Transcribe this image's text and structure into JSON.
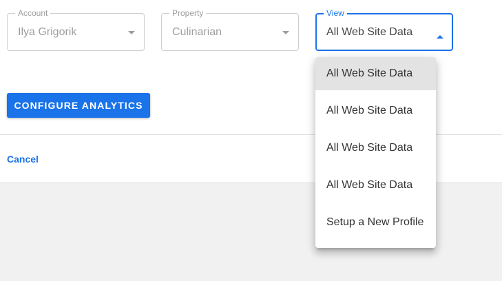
{
  "account": {
    "label": "Account",
    "value": "Ilya Grigorik"
  },
  "property": {
    "label": "Property",
    "value": "Culinarian"
  },
  "view": {
    "label": "View",
    "value": "All Web Site Data",
    "options": [
      {
        "label": "All Web Site Data",
        "selected": true
      },
      {
        "label": "All Web Site Data",
        "selected": false
      },
      {
        "label": "All Web Site Data",
        "selected": false
      },
      {
        "label": "All Web Site Data",
        "selected": false
      },
      {
        "label": "Setup a New Profile",
        "selected": false
      }
    ]
  },
  "actions": {
    "configure_label": "CONFIGURE ANALYTICS",
    "cancel_label": "Cancel"
  },
  "colors": {
    "accent": "#1a73e8",
    "disabled_text": "#9e9e9e",
    "backdrop": "#f1f1f1"
  },
  "icons": {
    "collapsed": "dropdown-arrow-icon",
    "expanded": "dropdown-arrow-up-icon"
  }
}
